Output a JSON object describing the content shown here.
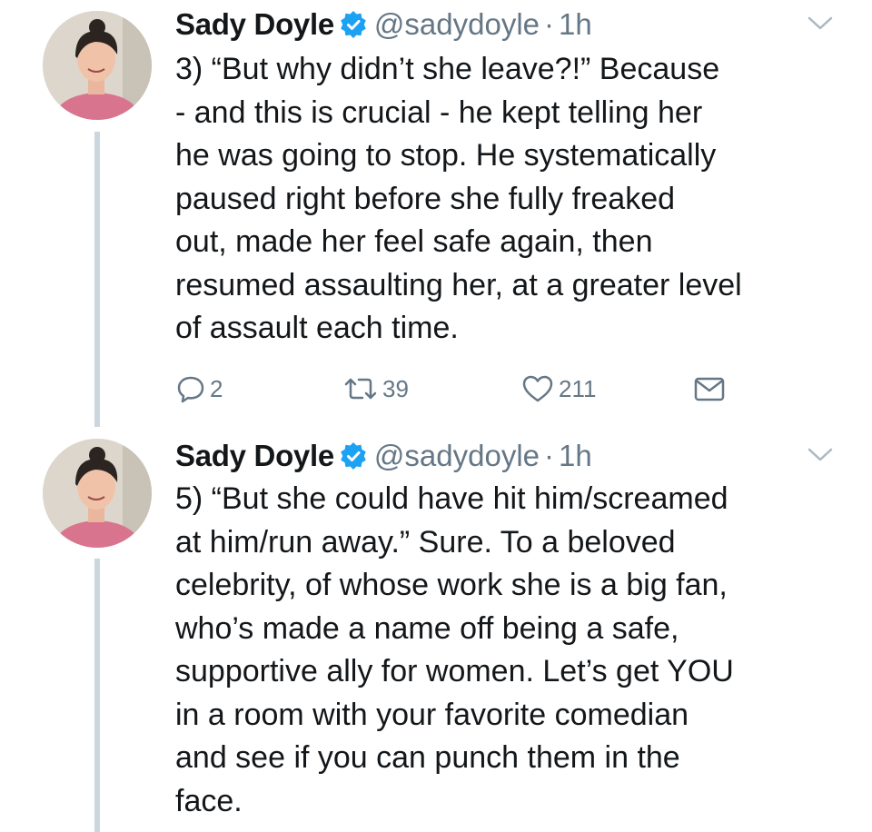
{
  "tweets": [
    {
      "name": "Sady Doyle",
      "handle": "@sadydoyle",
      "separator": "·",
      "time": "1h",
      "text": "3) “But why didn’t she leave?!” Because\n- and this is crucial - he kept telling her\nhe was going to stop. He systematically\npaused right before she fully freaked\nout, made her feel safe again, then\nresumed assaulting her, at a greater level\nof assault each time.",
      "replies": "2",
      "retweets": "39",
      "likes": "211"
    },
    {
      "name": "Sady Doyle",
      "handle": "@sadydoyle",
      "separator": "·",
      "time": "1h",
      "text": "5) “But she could have hit him/screamed\nat him/run away.” Sure. To a beloved\ncelebrity, of whose work she is a big fan,\nwho’s made a name off being a safe,\nsupportive ally for women. Let’s get YOU\nin a room with your favorite comedian\nand see if you can punch them in the\nface."
    }
  ],
  "colors": {
    "verified": "#1da1f2",
    "secondary_text": "#657786",
    "thread_line": "#ccd6dd"
  },
  "icons": [
    "verified-icon",
    "caret-down-icon",
    "reply-icon",
    "retweet-icon",
    "like-icon",
    "direct-message-icon"
  ]
}
